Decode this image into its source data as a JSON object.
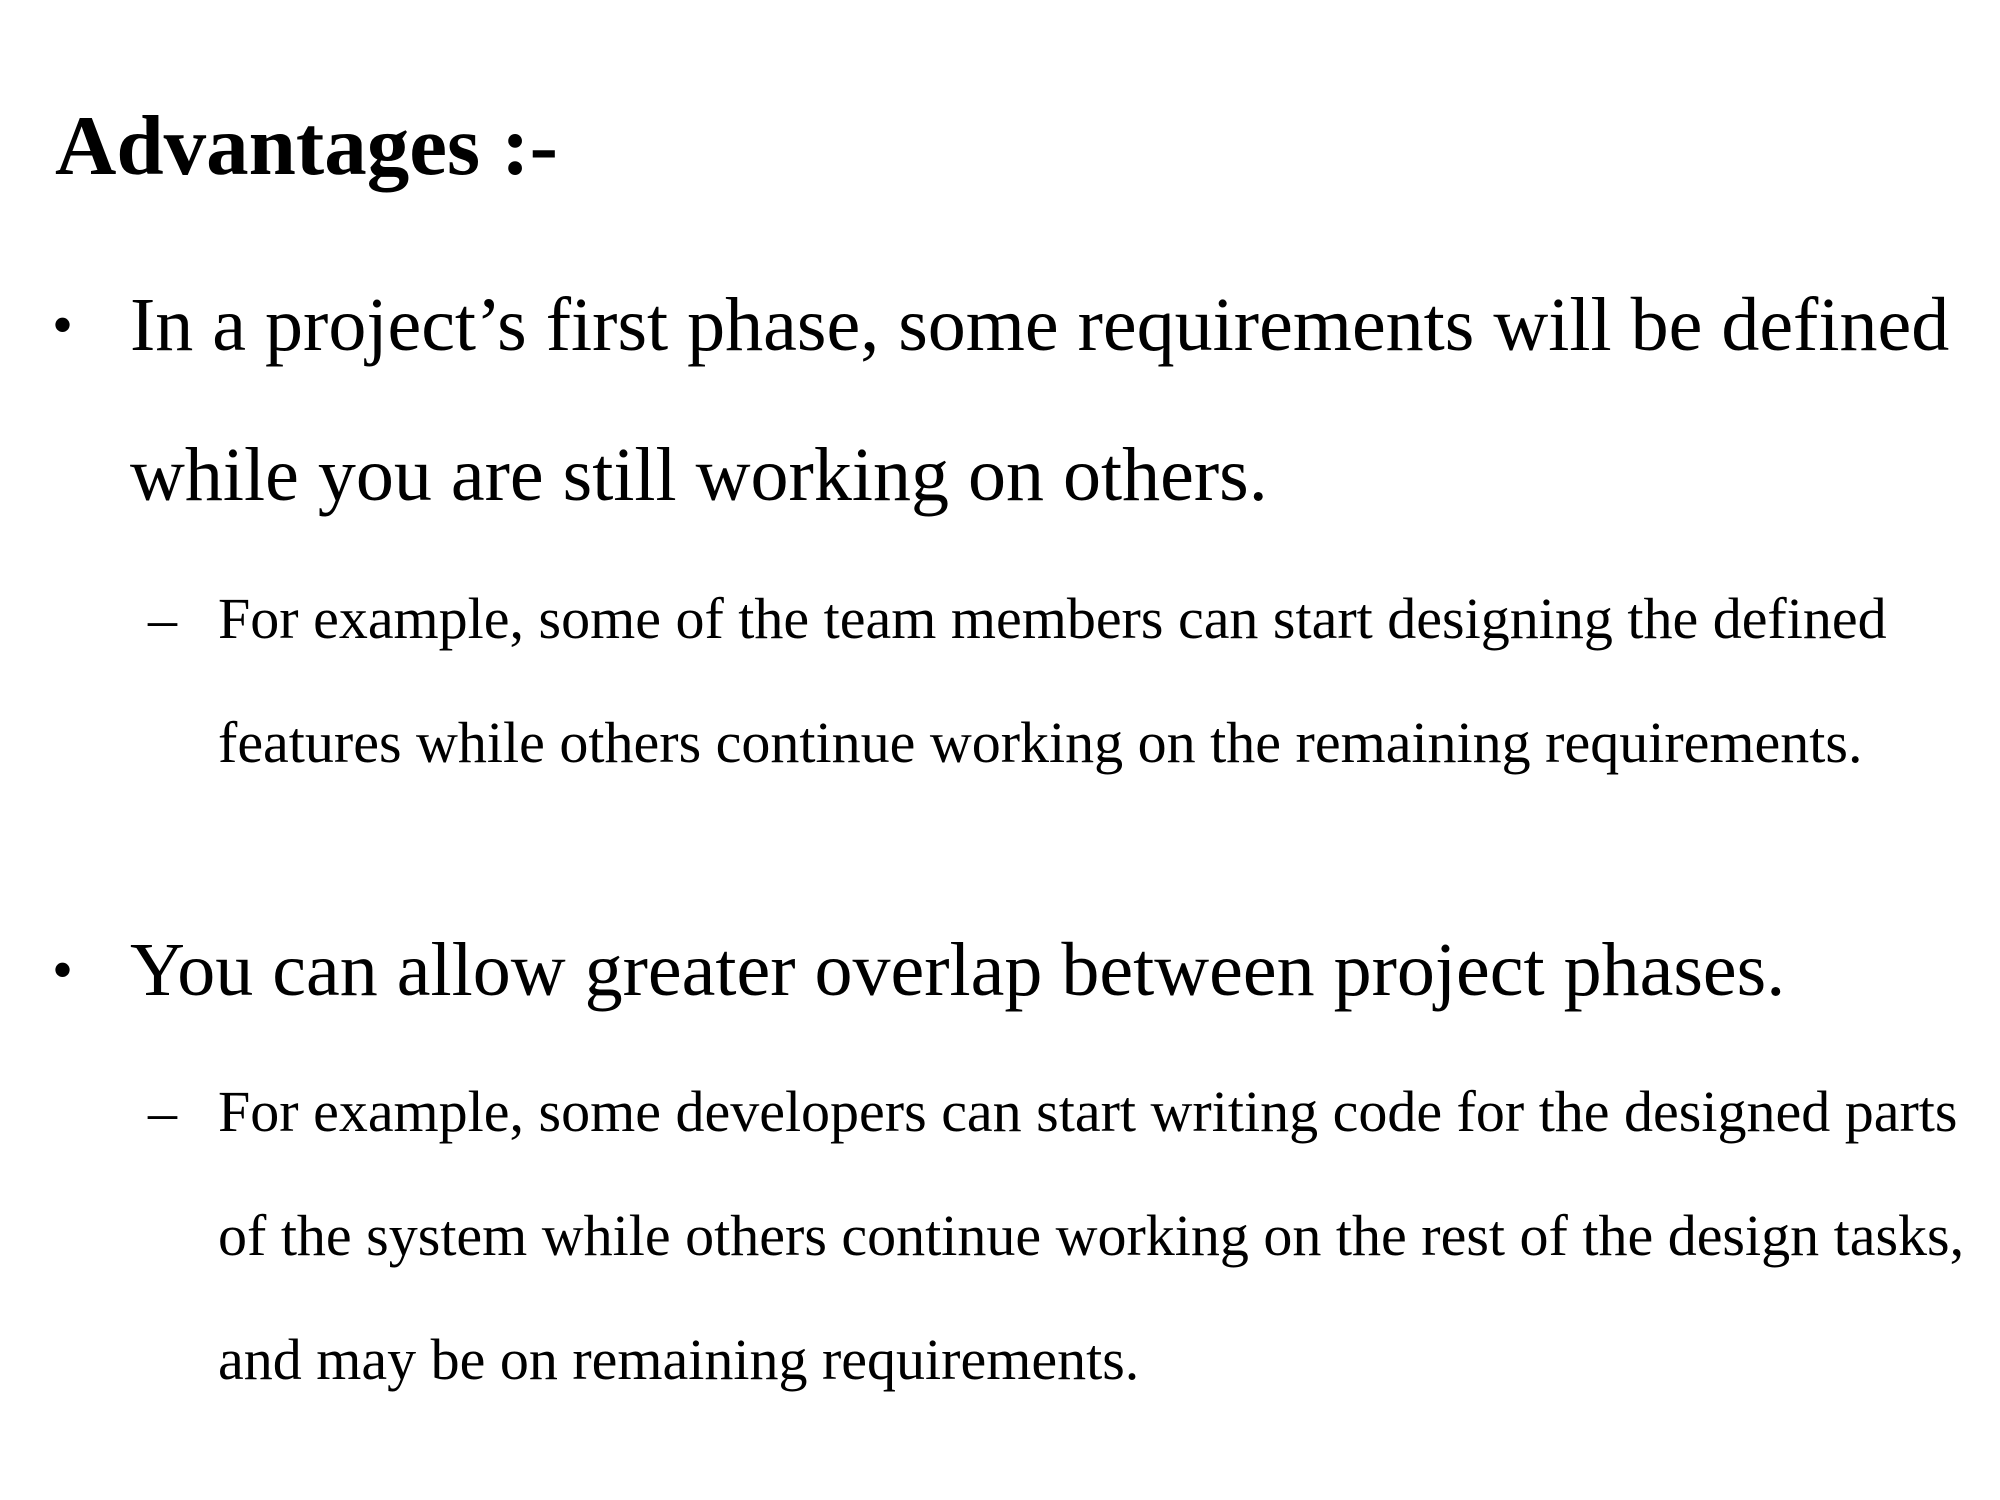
{
  "slide": {
    "title": "Advantages :-",
    "bullets": [
      {
        "marker": "•",
        "text": "In a project’s first phase, some requirements will be defined while you are still working on others.",
        "sub": {
          "marker": "–",
          "text": "For example, some of the team members can start designing the defined features while others continue working on the remaining requirements."
        }
      },
      {
        "marker": "•",
        "text": "You can allow greater overlap between project phases.",
        "sub": {
          "marker": "–",
          "text": "For example, some developers can start writing code for the designed parts of the system while others continue working on the rest of the design tasks, and may be on remaining requirements."
        }
      }
    ]
  }
}
